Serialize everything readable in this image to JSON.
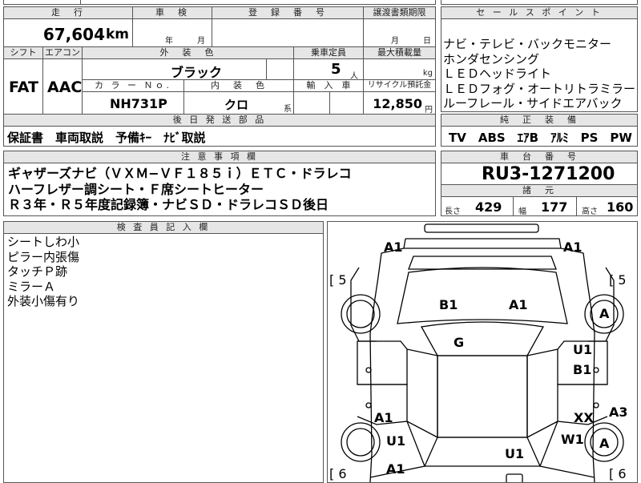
{
  "top": {
    "cut_left": "",
    "cut_mid": ""
  },
  "headers": {
    "mileage": "走　行",
    "inspection": "車　検",
    "registration": "登　録　番　号",
    "transfer_deadline": "譲渡書類期限",
    "sales_points": "セ ー ル ス ポ イ ン ト",
    "shift": "シフト",
    "aircon": "エアコン",
    "exterior_color": "外　装　色",
    "capacity": "乗車定員",
    "max_load": "最大積載量",
    "color_no": "カ ラ ー Ｎｏ.",
    "interior_color": "内　装　色",
    "import": "輸　入　車",
    "recycle": "リサイクル預託金",
    "accessories": "後 日 発 送 部 品",
    "genuine_equipment": "純　正　装　備",
    "notes": "注 意 事 項 欄",
    "chassis_no": "車　台　番　号",
    "specs": "諸　元",
    "inspector": "検 査 員 記 入 欄"
  },
  "vehicle": {
    "mileage": "67,604",
    "mileage_unit": "km",
    "inspection_year_unit": "年",
    "inspection_month_unit": "月",
    "transfer_month_unit": "月",
    "transfer_day_unit": "日",
    "shift": "FAT",
    "aircon": "AAC",
    "exterior_color": "ブラック",
    "capacity": "5",
    "capacity_unit": "人",
    "max_load_unit": "kg",
    "color_no": "NH731P",
    "interior_color": "クロ",
    "interior_suffix": "系",
    "recycle": "12,850",
    "recycle_unit": "円",
    "chassis_no": "RU3-1271200"
  },
  "sales_points": [
    "ナビ・テレビ・バックモニター",
    "ホンダセンシング",
    "ＬＥＤヘッドライト",
    "ＬＥＤフォグ・オートリトラミラー",
    "ルーフレール・サイドエアバック"
  ],
  "accessories": "保証書　車両取説　予備ｷｰ　ﾅﾋﾞ取説",
  "genuine_equipment": "TV　ABS　ｴｱB　ｱﾙﾐ　PS　PW",
  "notes": [
    "ギャザーズナビ（ＶＸＭ−ＶＦ１８５ｉ）ＥＴＣ・ドラレコ",
    "ハーフレザー調シート・Ｆ席シートヒーター",
    "Ｒ３年・Ｒ５年度記録簿・ナビＳＤ・ドラレコＳＤ後日"
  ],
  "specs": {
    "length_label": "長さ",
    "length": "429",
    "width_label": "幅",
    "width": "177",
    "height_label": "高さ",
    "height": "160"
  },
  "inspector_notes": [
    "シートしわ小",
    "ピラー内張傷",
    "タッチＰ跡",
    "ミラーＡ",
    "外装小傷有り"
  ],
  "diagram": {
    "a1_top_left": "A1",
    "a1_top_right": "A1",
    "bracket_5_left": "[ 5",
    "bracket_5_right": "[ 5",
    "b1_hood": "B1",
    "a1_hood": "A1",
    "g_windshield": "G",
    "a_wheel_front_right": "A",
    "u1_right_door": "U1",
    "b1_right_door": "B1",
    "a1_left_rear": "A1",
    "xx_right_rear": "XX",
    "a3_right": "A3",
    "u1_left_rear": "U1",
    "w1_right_rear": "W1",
    "a_wheel_rear_right": "A",
    "u1_roof_rear": "U1",
    "a1_bottom_left": "A1",
    "bracket_6_left": "[ 6",
    "bracket_6_right": "[ 6"
  }
}
